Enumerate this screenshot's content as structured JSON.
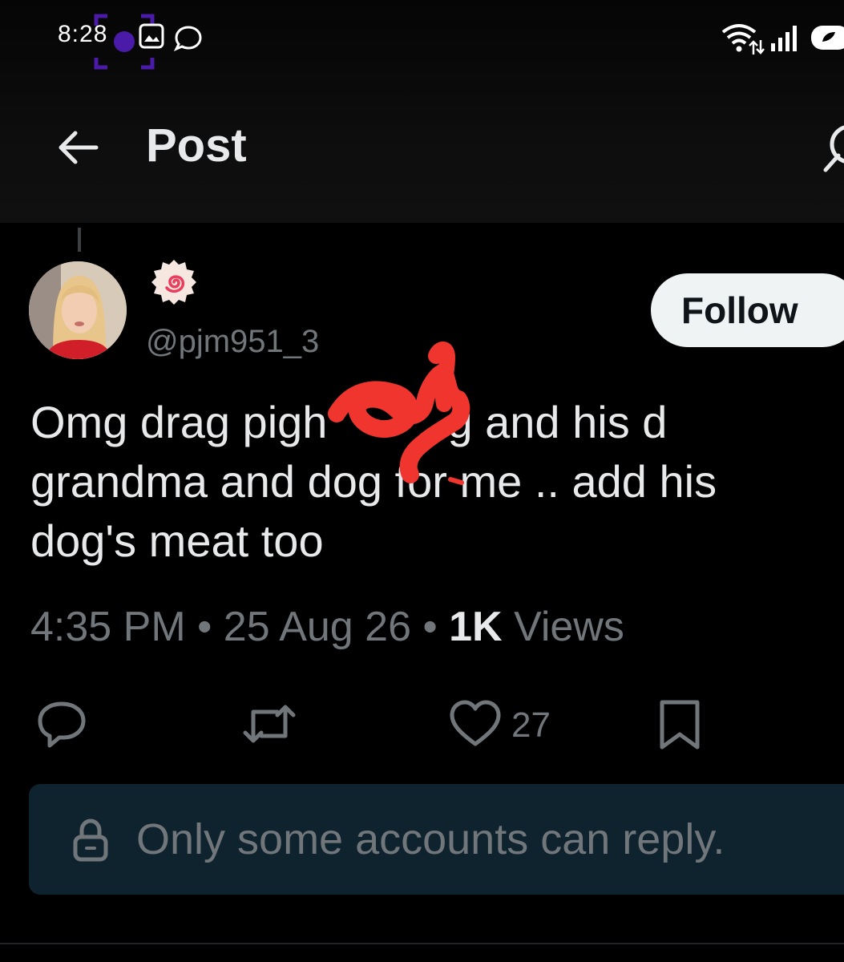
{
  "status_bar": {
    "time": "8:28",
    "icons": [
      "screen-record-icon",
      "gallery-icon",
      "chat-icon",
      "wifi-icon",
      "signal-icon",
      "battery-icon"
    ]
  },
  "header": {
    "back_icon": "back-arrow-icon",
    "title": "Post",
    "right_icon": "grok-icon"
  },
  "post": {
    "author_badge_icon": "spiral-badge-icon",
    "handle": "@pjm951_3",
    "follow_label": "Follow",
    "text_lines": [
      "Omg drag pigh",
      "g and his d",
      "grandma and dog for me .. add his",
      "dog's meat too"
    ],
    "timestamp": "4:35 PM",
    "separator": "•",
    "date": "25 Aug 26",
    "views_count": "1K",
    "views_label": "Views"
  },
  "actions": {
    "reply_icon": "reply-icon",
    "retweet_icon": "retweet-icon",
    "like_icon": "heart-icon",
    "like_count": "27",
    "bookmark_icon": "bookmark-icon"
  },
  "reply_restriction": {
    "icon": "lock-icon",
    "text": "Only some accounts can reply."
  },
  "colors": {
    "background": "#000000",
    "text_primary": "#e7e9ea",
    "text_secondary": "#71767b",
    "banner_bg": "#0e232e",
    "follow_bg": "#eff3f4",
    "redaction": "#f0352e"
  }
}
